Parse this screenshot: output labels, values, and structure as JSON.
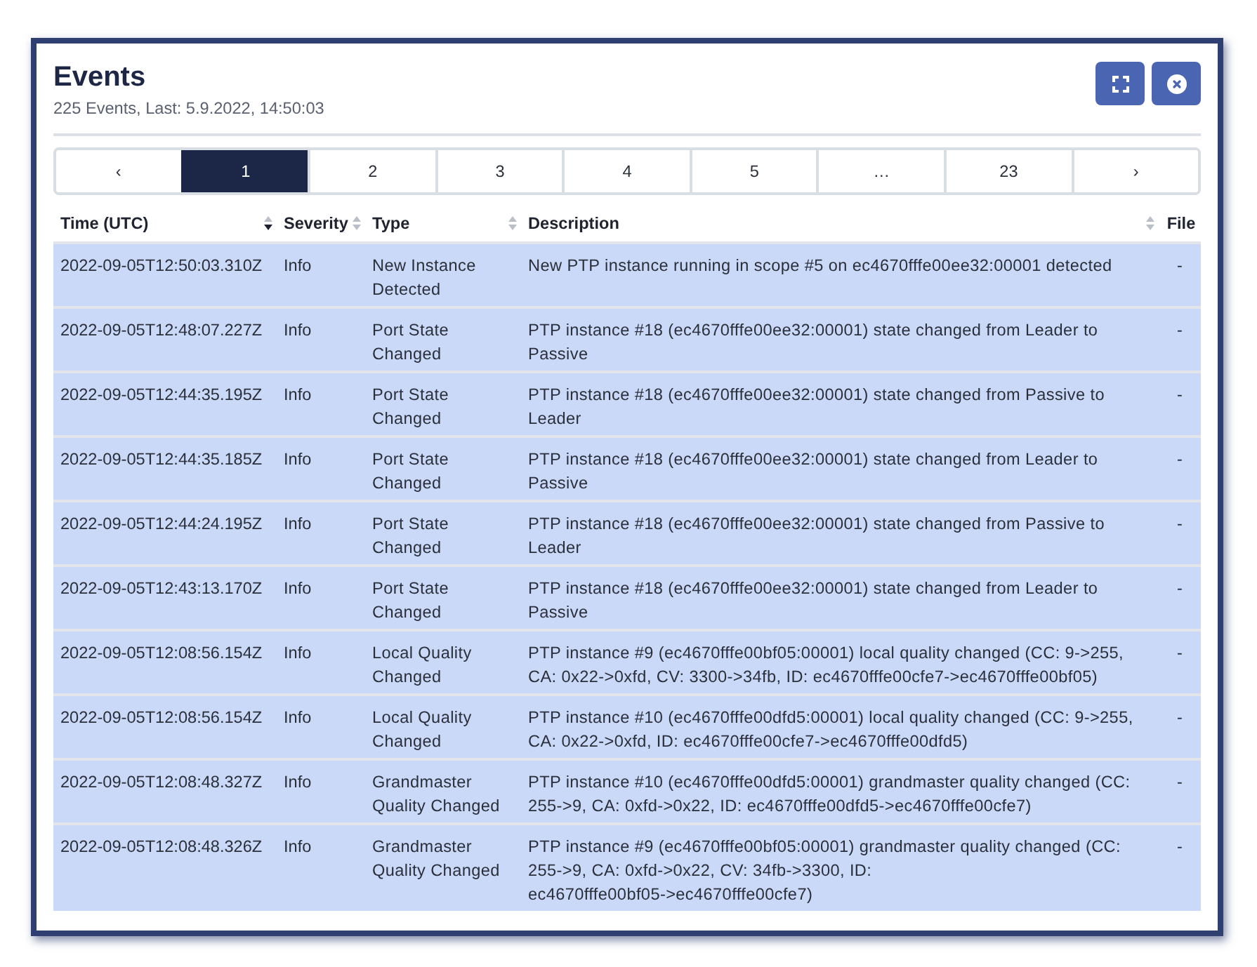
{
  "dialog": {
    "title": "Events",
    "subtitle": "225 Events, Last: 5.9.2022, 14:50:03",
    "actions": [
      {
        "kind": "fullscreen"
      },
      {
        "kind": "close"
      }
    ]
  },
  "pagination": [
    {
      "label": "‹",
      "selected": false
    },
    {
      "label": "1",
      "selected": true
    },
    {
      "label": "2",
      "selected": false
    },
    {
      "label": "3",
      "selected": false
    },
    {
      "label": "4",
      "selected": false
    },
    {
      "label": "5",
      "selected": false
    },
    {
      "label": "…",
      "selected": false
    },
    {
      "label": "23",
      "selected": false
    },
    {
      "label": "›",
      "selected": false
    }
  ],
  "table": {
    "columns": [
      {
        "label": "Time (UTC)",
        "sortable": true,
        "sorted_descending": true
      },
      {
        "label": "Severity",
        "sortable": true,
        "sorted_descending": false
      },
      {
        "label": "Type",
        "sortable": true,
        "sorted_descending": false
      },
      {
        "label": "Description",
        "sortable": true,
        "sorted_descending": false
      },
      {
        "label": "File",
        "sortable": false
      }
    ],
    "rows": [
      {
        "time": "2022-09-05T12:50:03.310Z",
        "severity": "Info",
        "type": "New Instance Detected",
        "description": "New PTP instance running in scope #5 on ec4670fffe00ee32:00001 detected",
        "file": "-"
      },
      {
        "time": "2022-09-05T12:48:07.227Z",
        "severity": "Info",
        "type": "Port State Changed",
        "description": "PTP instance #18 (ec4670fffe00ee32:00001) state changed from Leader to Passive",
        "file": "-"
      },
      {
        "time": "2022-09-05T12:44:35.195Z",
        "severity": "Info",
        "type": "Port State Changed",
        "description": "PTP instance #18 (ec4670fffe00ee32:00001) state changed from Passive to Leader",
        "file": "-"
      },
      {
        "time": "2022-09-05T12:44:35.185Z",
        "severity": "Info",
        "type": "Port State Changed",
        "description": "PTP instance #18 (ec4670fffe00ee32:00001) state changed from Leader to Passive",
        "file": "-"
      },
      {
        "time": "2022-09-05T12:44:24.195Z",
        "severity": "Info",
        "type": "Port State Changed",
        "description": "PTP instance #18 (ec4670fffe00ee32:00001) state changed from Passive to Leader",
        "file": "-"
      },
      {
        "time": "2022-09-05T12:43:13.170Z",
        "severity": "Info",
        "type": "Port State Changed",
        "description": "PTP instance #18 (ec4670fffe00ee32:00001) state changed from Leader to Passive",
        "file": "-"
      },
      {
        "time": "2022-09-05T12:08:56.154Z",
        "severity": "Info",
        "type": "Local Quality Changed",
        "description": "PTP instance #9 (ec4670fffe00bf05:00001) local quality changed (CC: 9->255, CA: 0x22->0xfd, CV: 3300->34fb, ID: ec4670fffe00cfe7->ec4670fffe00bf05)",
        "file": "-"
      },
      {
        "time": "2022-09-05T12:08:56.154Z",
        "severity": "Info",
        "type": "Local Quality Changed",
        "description": "PTP instance #10 (ec4670fffe00dfd5:00001) local quality changed (CC: 9->255, CA: 0x22->0xfd, ID: ec4670fffe00cfe7->ec4670fffe00dfd5)",
        "file": "-"
      },
      {
        "time": "2022-09-05T12:08:48.327Z",
        "severity": "Info",
        "type": "Grandmaster Quality Changed",
        "description": "PTP instance #10 (ec4670fffe00dfd5:00001) grandmaster quality changed (CC: 255->9, CA: 0xfd->0x22, ID: ec4670fffe00dfd5->ec4670fffe00cfe7)",
        "file": "-"
      },
      {
        "time": "2022-09-05T12:08:48.326Z",
        "severity": "Info",
        "type": "Grandmaster Quality Changed",
        "description": "PTP instance #9 (ec4670fffe00bf05:00001) grandmaster quality changed (CC: 255->9, CA: 0xfd->0x22, CV: 34fb->3300, ID: ec4670fffe00bf05->ec4670fffe00cfe7)",
        "file": "-"
      }
    ]
  }
}
